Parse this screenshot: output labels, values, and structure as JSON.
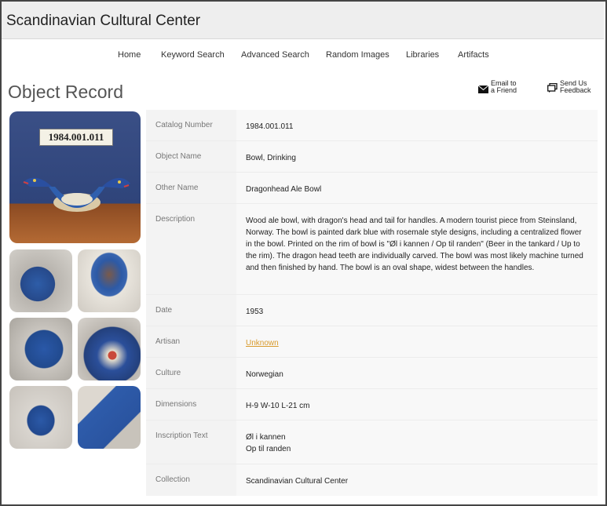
{
  "header": {
    "site_title": "Scandinavian Cultural Center"
  },
  "nav": {
    "items": [
      {
        "label": "Home"
      },
      {
        "label": "Keyword Search"
      },
      {
        "label": "Advanced Search"
      },
      {
        "label": "Random Images"
      },
      {
        "label": "Libraries"
      },
      {
        "label": "Artifacts"
      }
    ]
  },
  "page": {
    "title": "Object Record"
  },
  "tools": {
    "email": {
      "line1": "Email to",
      "line2": "a Friend",
      "icon": "envelope-icon"
    },
    "feedback": {
      "line1": "Send Us",
      "line2": "Feedback",
      "icon": "speech-bubble-icon"
    }
  },
  "images": {
    "main_tag": "1984.001.011"
  },
  "record": {
    "rows": [
      {
        "label": "Catalog Number",
        "value": "1984.001.011"
      },
      {
        "label": "Object Name",
        "value": "Bowl, Drinking"
      },
      {
        "label": "Other Name",
        "value": "Dragonhead Ale Bowl"
      },
      {
        "label": "Description",
        "value": "Wood ale bowl, with dragon's head and tail for handles. A modern tourist piece from Steinsland, Norway. The bowl is painted dark blue with rosemale style designs, including a centralized flower in the bowl. Printed on the rim of bowl is \"Øl i kannen / Op til randen\" (Beer in the tankard / Up to the rim). The dragon head teeth are individually carved. The bowl was most likely machine turned and then finished by hand. The bowl is an oval shape, widest between the handles."
      },
      {
        "label": "Date",
        "value": "1953"
      },
      {
        "label": "Artisan",
        "value": "Unknown"
      },
      {
        "label": "Culture",
        "value": "Norwegian"
      },
      {
        "label": "Dimensions",
        "value": "H-9 W-10 L-21 cm"
      },
      {
        "label": "Inscription Text",
        "value_line1": "Øl i kannen",
        "value_line2": "Op til randen"
      },
      {
        "label": "Collection",
        "value": "Scandinavian Cultural Center"
      }
    ]
  },
  "colors": {
    "link": "#d89a2c",
    "topbar": "#eeeeee",
    "bowl_blue": "#2f5fae"
  }
}
